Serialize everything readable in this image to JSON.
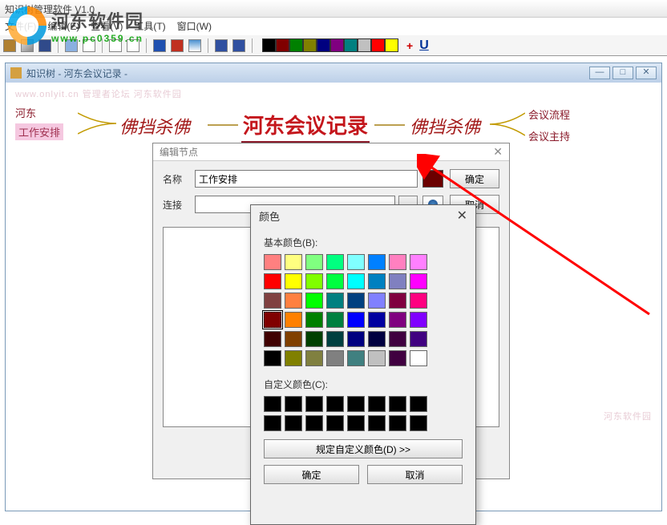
{
  "app": {
    "title": "知识树管理软件 V1.0"
  },
  "watermark": {
    "site_name": "河东软件园",
    "url": "www.pc0359.cn"
  },
  "menu": {
    "items": [
      "文件(F)",
      "编辑(E)",
      "查看(V)",
      "工具(T)",
      "窗口(W)"
    ]
  },
  "toolbar": {
    "colors": [
      "#000000",
      "#800000",
      "#008000",
      "#808000",
      "#000080",
      "#800080",
      "#008080",
      "#c0c0c0",
      "#ff0000",
      "#ffff00"
    ]
  },
  "child": {
    "title": "知识树 - 河东会议记录 -",
    "faint_links": "www.onlyit.cn   管理者论坛   河东软件园",
    "faint_rb": "河东软件园",
    "left": {
      "l1": "河东",
      "l2": "工作安排"
    },
    "mid1": "佛挡杀佛",
    "center": "河东会议记录",
    "mid2": "佛挡杀佛",
    "right": {
      "r1": "会议流程",
      "r2": "会议主持"
    }
  },
  "edit": {
    "title": "编辑节点",
    "name_label": "名称",
    "name_value": "工作安排",
    "link_label": "连接",
    "link_value": "",
    "ok": "确定",
    "cancel": "取消",
    "color_value": "#6b0000"
  },
  "colordlg": {
    "title": "颜色",
    "basic_label": "基本颜色(B):",
    "custom_label": "自定义颜色(C):",
    "define_btn": "规定自定义颜色(D) >>",
    "ok": "确定",
    "cancel": "取消",
    "basic_colors": [
      "#ff8080",
      "#ffff80",
      "#80ff80",
      "#00ff80",
      "#80ffff",
      "#0080ff",
      "#ff80c0",
      "#ff80ff",
      "#ff0000",
      "#ffff00",
      "#80ff00",
      "#00ff40",
      "#00ffff",
      "#0080c0",
      "#8080c0",
      "#ff00ff",
      "#804040",
      "#ff8040",
      "#00ff00",
      "#008080",
      "#004080",
      "#8080ff",
      "#800040",
      "#ff0080",
      "#800000",
      "#ff8000",
      "#008000",
      "#008040",
      "#0000ff",
      "#0000a0",
      "#800080",
      "#8000ff",
      "#400000",
      "#804000",
      "#004000",
      "#004040",
      "#000080",
      "#000040",
      "#400040",
      "#400080",
      "#000000",
      "#808000",
      "#808040",
      "#808080",
      "#408080",
      "#c0c0c0",
      "#400040",
      "#ffffff"
    ],
    "selected_index": 24,
    "custom_colors": [
      "#000000",
      "#000000",
      "#000000",
      "#000000",
      "#000000",
      "#000000",
      "#000000",
      "#000000",
      "#000000",
      "#000000",
      "#000000",
      "#000000",
      "#000000",
      "#000000",
      "#000000",
      "#000000"
    ]
  }
}
